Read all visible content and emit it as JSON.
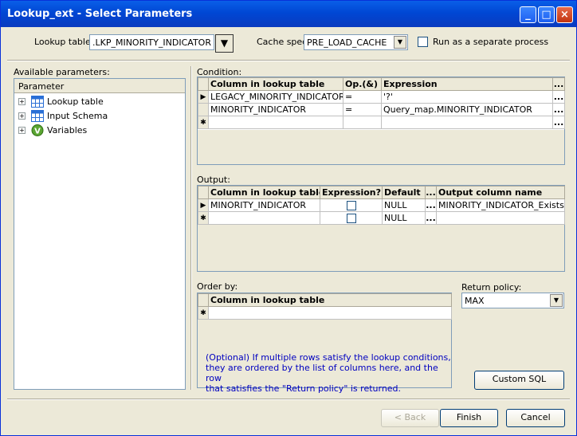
{
  "window": {
    "title": "Lookup_ext - Select Parameters"
  },
  "lookup_table": {
    "label": "Lookup table:",
    "value": ".LKP_MINORITY_INDICATOR"
  },
  "cache_spec": {
    "label": "Cache spec:",
    "value": "PRE_LOAD_CACHE"
  },
  "separate_process": {
    "label": "Run as a separate process",
    "checked": false
  },
  "available_parameters": {
    "label": "Available parameters:",
    "header": "Parameter",
    "items": [
      {
        "label": "Lookup table",
        "icon": "table-icon"
      },
      {
        "label": "Input Schema",
        "icon": "table-icon"
      },
      {
        "label": "Variables",
        "icon": "variable-icon"
      }
    ]
  },
  "condition": {
    "label": "Condition:",
    "headers": [
      "Column in lookup table",
      "Op.(&)",
      "Expression"
    ],
    "rows": [
      [
        "LEGACY_MINORITY_INDICATOR",
        "=",
        "'?'"
      ],
      [
        "MINORITY_INDICATOR",
        "=",
        "Query_map.MINORITY_INDICATOR"
      ]
    ],
    "ellipsis": "..."
  },
  "output": {
    "label": "Output:",
    "headers": [
      "Column in lookup table",
      "Expression?",
      "Default",
      "...",
      "Output column name"
    ],
    "rows": [
      {
        "column": "MINORITY_INDICATOR",
        "default": "NULL",
        "output_name": "MINORITY_INDICATOR_Exists"
      },
      {
        "column": "",
        "default": "NULL",
        "output_name": ""
      }
    ],
    "ellipsis": "..."
  },
  "order_by": {
    "label": "Order by:",
    "header": "Column in lookup table",
    "note_lines": [
      "(Optional) If multiple rows satisfy the lookup conditions,",
      "they are ordered by the list of columns here, and the row",
      "that satisfies the \"Return policy\" is returned."
    ]
  },
  "return_policy": {
    "label": "Return policy:",
    "value": "MAX"
  },
  "buttons": {
    "custom_sql": "Custom SQL",
    "back": "< Back",
    "finish": "Finish",
    "cancel": "Cancel"
  },
  "markers": {
    "current": "▶",
    "new": "✱"
  }
}
